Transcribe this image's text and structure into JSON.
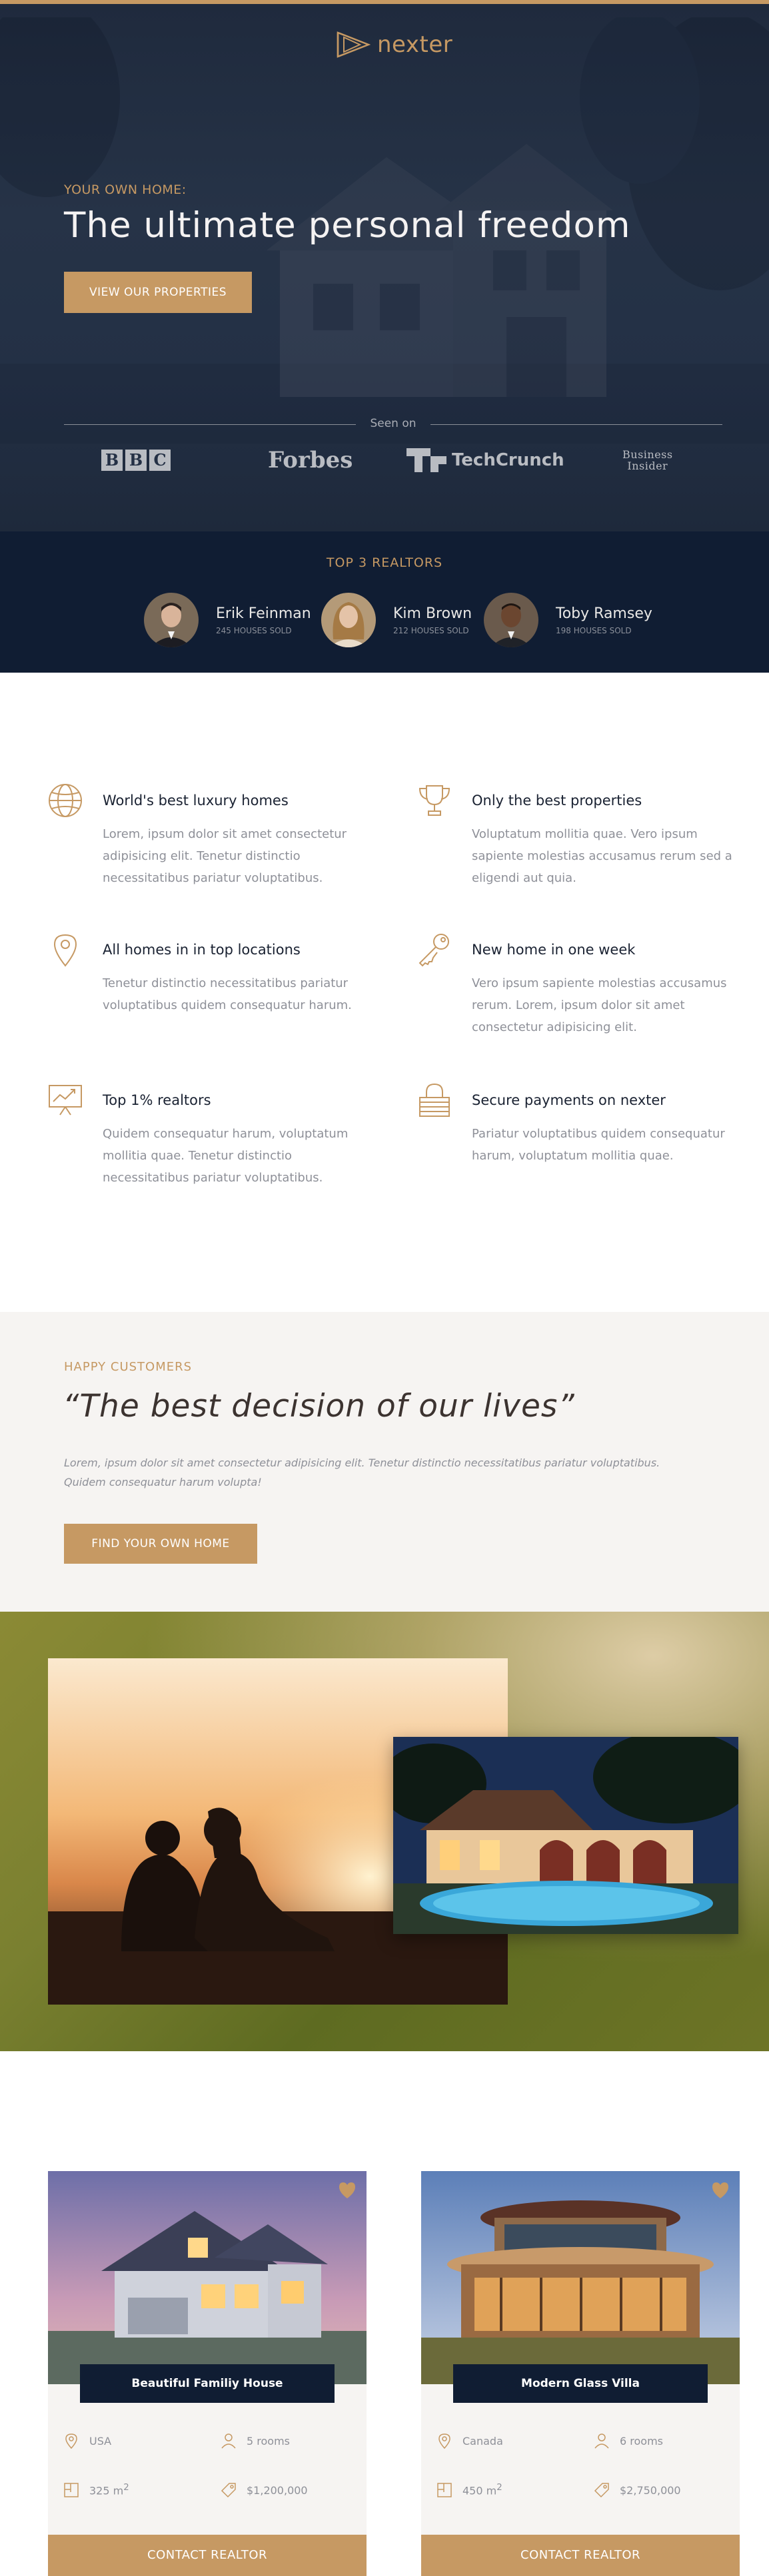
{
  "brand": {
    "name": "nexter"
  },
  "colors": {
    "accent": "#c69963",
    "navy": "#101d33",
    "light": "#f6f4f2",
    "text": "#1a2232",
    "muted": "#8e9098"
  },
  "hero": {
    "subtitle": "YOUR OWN HOME:",
    "title": "The ultimate personal freedom",
    "button": "VIEW OUR PROPERTIES",
    "seen_on": "Seen on",
    "logos": {
      "bbc": [
        "B",
        "B",
        "C"
      ],
      "forbes": "Forbes",
      "techcrunch": "TechCrunch",
      "business_insider_1": "Business",
      "business_insider_2": "Insider"
    }
  },
  "realtors": {
    "title": "TOP 3 REALTORS",
    "items": [
      {
        "name": "Erik Feinman",
        "sold": "245 HOUSES SOLD"
      },
      {
        "name": "Kim Brown",
        "sold": "212 HOUSES SOLD"
      },
      {
        "name": "Toby Ramsey",
        "sold": "198 HOUSES SOLD"
      }
    ]
  },
  "features": [
    {
      "icon": "globe-icon",
      "title": "World's best luxury homes",
      "text": "Lorem, ipsum dolor sit amet consectetur adipisicing elit. Tenetur distinctio necessitatibus pariatur voluptatibus."
    },
    {
      "icon": "trophy-icon",
      "title": "Only the best properties",
      "text": "Voluptatum mollitia quae. Vero ipsum sapiente molestias accusamus rerum sed a eligendi aut quia."
    },
    {
      "icon": "map-pin-icon",
      "title": "All homes in in top locations",
      "text": "Tenetur distinctio necessitatibus pariatur voluptatibus quidem consequatur harum."
    },
    {
      "icon": "key-icon",
      "title": "New home in one week",
      "text": "Vero ipsum sapiente molestias accusamus rerum. Lorem, ipsum dolor sit amet consectetur adipisicing elit."
    },
    {
      "icon": "presentation-chart-icon",
      "title": "Top 1% realtors",
      "text": "Quidem consequatur harum, voluptatum mollitia quae. Tenetur distinctio necessitatibus pariatur voluptatibus."
    },
    {
      "icon": "lock-icon",
      "title": "Secure payments on nexter",
      "text": "Pariatur voluptatibus quidem consequatur harum, voluptatum mollitia quae."
    }
  ],
  "story": {
    "label": "HAPPY CUSTOMERS",
    "quote": "“The best decision of our lives”",
    "text": "Lorem, ipsum dolor sit amet consectetur adipisicing elit. Tenetur distinctio necessitatibus pariatur voluptatibus. Quidem consequatur harum volupta!",
    "button": "FIND YOUR OWN HOME"
  },
  "homes": [
    {
      "name": "Beautiful Familiy House",
      "location": "USA",
      "rooms": "5 rooms",
      "area": "325 m",
      "area_sup": "2",
      "price": "$1,200,000",
      "button": "CONTACT REALTOR"
    },
    {
      "name": "Modern Glass Villa",
      "location": "Canada",
      "rooms": "6 rooms",
      "area": "450 m",
      "area_sup": "2",
      "price": "$2,750,000",
      "button": "CONTACT REALTOR"
    }
  ]
}
